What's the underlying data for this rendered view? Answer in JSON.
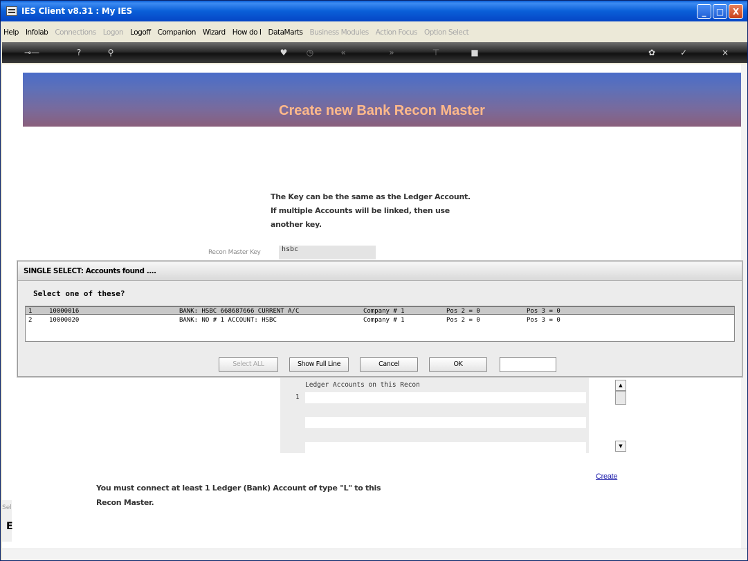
{
  "window": {
    "title": "IES Client v8.31 : My IES",
    "buttons": {
      "minimize": "_",
      "maximize": "□",
      "close": "X"
    }
  },
  "menu": {
    "items": [
      {
        "label": "Help",
        "enabled": true
      },
      {
        "label": "Infolab",
        "enabled": true
      },
      {
        "label": "Connections",
        "enabled": false
      },
      {
        "label": "Logon",
        "enabled": false
      },
      {
        "label": "Logoff",
        "enabled": true
      },
      {
        "label": "Companion",
        "enabled": true
      },
      {
        "label": "Wizard",
        "enabled": true
      },
      {
        "label": "How do I",
        "enabled": true
      },
      {
        "label": "DataMarts",
        "enabled": true
      },
      {
        "label": "Business Modules",
        "enabled": false
      },
      {
        "label": "Action Focus",
        "enabled": false
      },
      {
        "label": "Option Select",
        "enabled": false
      }
    ]
  },
  "toolbar": {
    "icons": [
      "key-icon",
      "help-icon",
      "search-icon",
      "heart-icon",
      "clock-icon",
      "rewind-icon",
      "forward-icon",
      "tree-icon",
      "stop-icon",
      "gear-icon",
      "check-icon",
      "close-icon"
    ]
  },
  "page": {
    "banner_title": "Create new Bank Recon Master",
    "info_text": "The Key can be the same as the Ledger Account. If multiple Accounts will be linked, then use another key.",
    "recon_key_label": "Recon Master Key",
    "recon_key_value": "hsbc",
    "ledger_header": "Ledger Accounts on this Recon",
    "ledger_first_row": "1",
    "create_link": "Create",
    "warning_line1": "You must connect at least  1 Ledger  (Bank) Account of type \"L\" to this",
    "warning_line2": "Recon Master.",
    "left_stub_text": "Sel",
    "left_stub_glyph": "E"
  },
  "dialog": {
    "title": "SINGLE SELECT: Accounts found ....",
    "prompt": "Select one of these?",
    "rows": [
      {
        "idx": "1",
        "account": "10000016",
        "description": "BANK: HSBC 668687666 CURRENT A/C",
        "company": "Company # 1",
        "pos2": "Pos 2 = 0",
        "pos3": "Pos 3 = 0",
        "selected": true
      },
      {
        "idx": "2",
        "account": "10000020",
        "description": "BANK: NO # 1 ACCOUNT: HSBC",
        "company": "Company # 1",
        "pos2": "Pos 2 = 0",
        "pos3": "Pos 3 = 0",
        "selected": false
      }
    ],
    "buttons": {
      "select_all": "Select ALL",
      "show_full_line": "Show Full Line",
      "cancel": "Cancel",
      "ok": "OK"
    },
    "filter_value": ""
  }
}
